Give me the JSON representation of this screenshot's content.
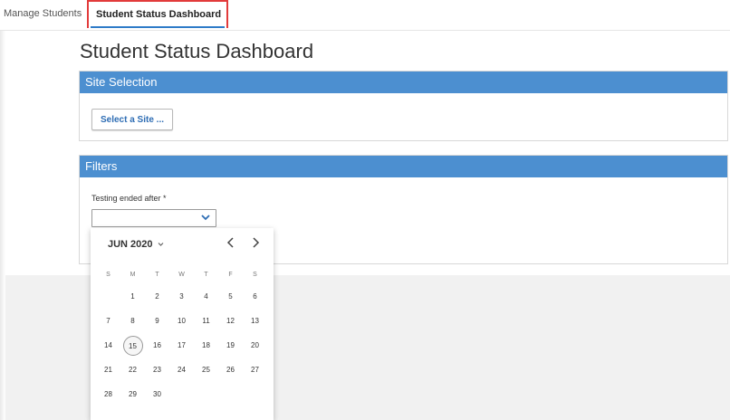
{
  "tabs": {
    "manage_students": "Manage Students",
    "dashboard": "Student Status Dashboard"
  },
  "page": {
    "title": "Student Status Dashboard"
  },
  "site_selection": {
    "header": "Site Selection",
    "button_label": "Select a Site ..."
  },
  "filters": {
    "header": "Filters",
    "testing_label": "Testing ended after *",
    "testing_value": ""
  },
  "calendar": {
    "month_label": "JUN 2020",
    "weekdays": [
      "S",
      "M",
      "T",
      "W",
      "T",
      "F",
      "S"
    ],
    "first_weekday_index": 1,
    "days_in_month": 30,
    "selected_day": 15
  },
  "icons": {
    "dropdown": "chevron-down-icon",
    "prev": "chevron-left-icon",
    "next": "chevron-right-icon",
    "month_caret": "caret-down-icon"
  },
  "colors": {
    "panel_header": "#4c8fd0",
    "active_tab_highlight": "#e23b3b",
    "tab_underline": "#2e7bc8",
    "link_text": "#2e6db4"
  }
}
